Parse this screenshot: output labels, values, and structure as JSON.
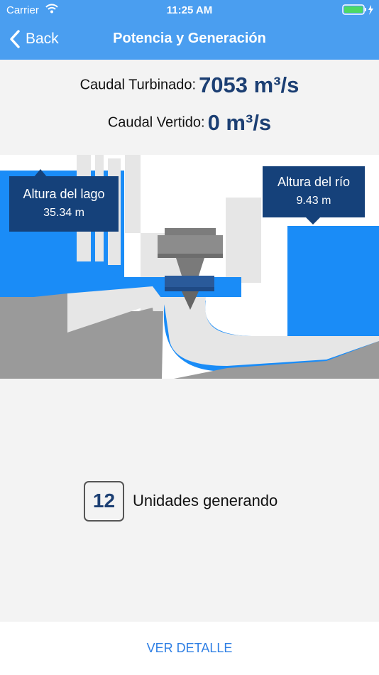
{
  "status_bar": {
    "carrier": "Carrier",
    "time": "11:25 AM"
  },
  "nav": {
    "back_label": "Back",
    "title": "Potencia y Generación"
  },
  "flows": {
    "turbined_label": "Caudal Turbinado:",
    "turbined_value": "7053 m³/s",
    "spilled_label": "Caudal Vertido:",
    "spilled_value": "0 m³/s"
  },
  "lake": {
    "label": "Altura del lago",
    "value": "35.34 m"
  },
  "river": {
    "label": "Altura del río",
    "value": "9.43 m"
  },
  "units": {
    "count": "12",
    "label": "Unidades generando"
  },
  "footer": {
    "detail_label": "VER DETALLE"
  },
  "colors": {
    "nav_bar": "#4a9ef0",
    "water": "#1a8cf7",
    "tooltip": "#15417a",
    "value_text": "#1c3f73",
    "link": "#2f7fe4",
    "concrete": "#9a9a9a",
    "structure": "#e6e6e6"
  }
}
